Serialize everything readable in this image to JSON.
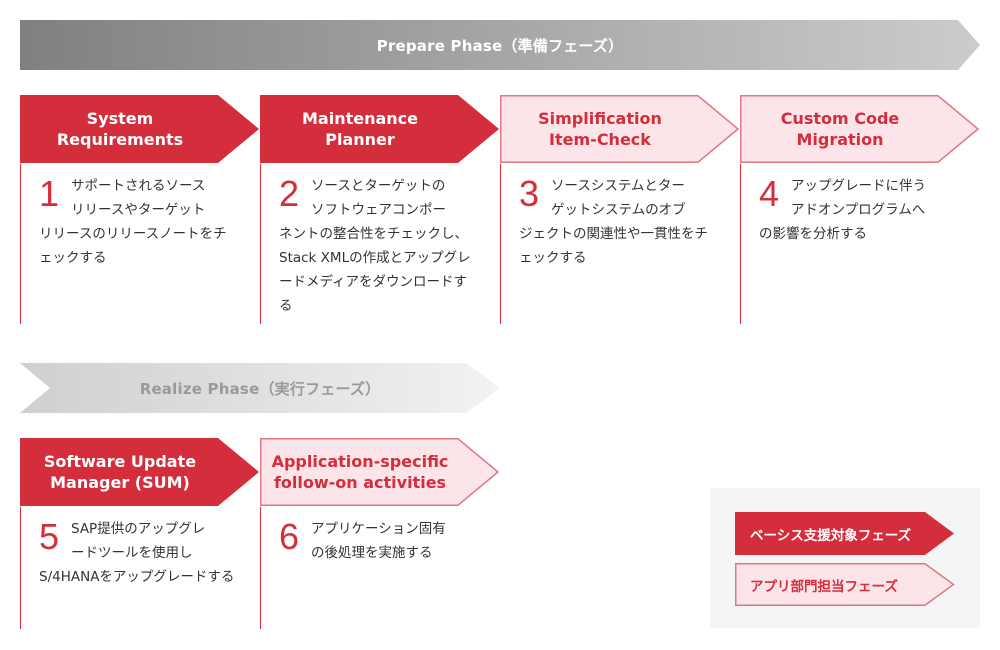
{
  "colors": {
    "basis_red": "#d42d3c",
    "app_pink_fill": "#fbe5e8",
    "app_pink_border": "#e07882",
    "desc_text": "#333333",
    "prepare_gradient_start": "#808080",
    "prepare_gradient_end": "#cccccc",
    "realize_gradient_start": "#cfcfcf",
    "realize_gradient_end": "#f2f2f2",
    "legend_bg": "#f5f5f5"
  },
  "phases": {
    "prepare": {
      "label": "Prepare Phase（準備フェーズ）"
    },
    "realize": {
      "label": "Realize Phase（実行フェーズ）"
    }
  },
  "steps": [
    {
      "number": "1",
      "title": "System\nRequirements",
      "type": "basis",
      "desc_first": "サポートされるソース",
      "desc_second": "リリースやターゲット",
      "desc_rest": "リリースのリリースノートをチェックする"
    },
    {
      "number": "2",
      "title": "Maintenance\nPlanner",
      "type": "basis",
      "desc_first": "ソースとターゲットの",
      "desc_second": "ソフトウェアコンポー",
      "desc_rest": "ネントの整合性をチェックし、Stack XMLの作成とアップグレードメディアをダウンロードする"
    },
    {
      "number": "3",
      "title": "Simplification\nItem-Check",
      "type": "app",
      "desc_first": "ソースシステムとター",
      "desc_second": "ゲットシステムのオブ",
      "desc_rest": "ジェクトの関連性や一貫性をチェックする"
    },
    {
      "number": "4",
      "title": "Custom Code\nMigration",
      "type": "app",
      "desc_first": "アップグレードに伴う",
      "desc_second": "アドオンプログラムへ",
      "desc_rest": "の影響を分析する"
    },
    {
      "number": "5",
      "title": "Software Update\nManager (SUM)",
      "type": "basis",
      "desc_first": "SAP提供のアップグレ",
      "desc_second": "ードツールを使用し",
      "desc_rest": "S/4HANAをアップグレードする"
    },
    {
      "number": "6",
      "title": "Application-specific\nfollow-on activities",
      "type": "app",
      "desc_first": "アプリケーション固有",
      "desc_second": "の後処理を実施する",
      "desc_rest": ""
    }
  ],
  "legend": {
    "basis_label": "ベーシス支援対象フェーズ",
    "app_label": "アプリ部門担当フェーズ"
  }
}
